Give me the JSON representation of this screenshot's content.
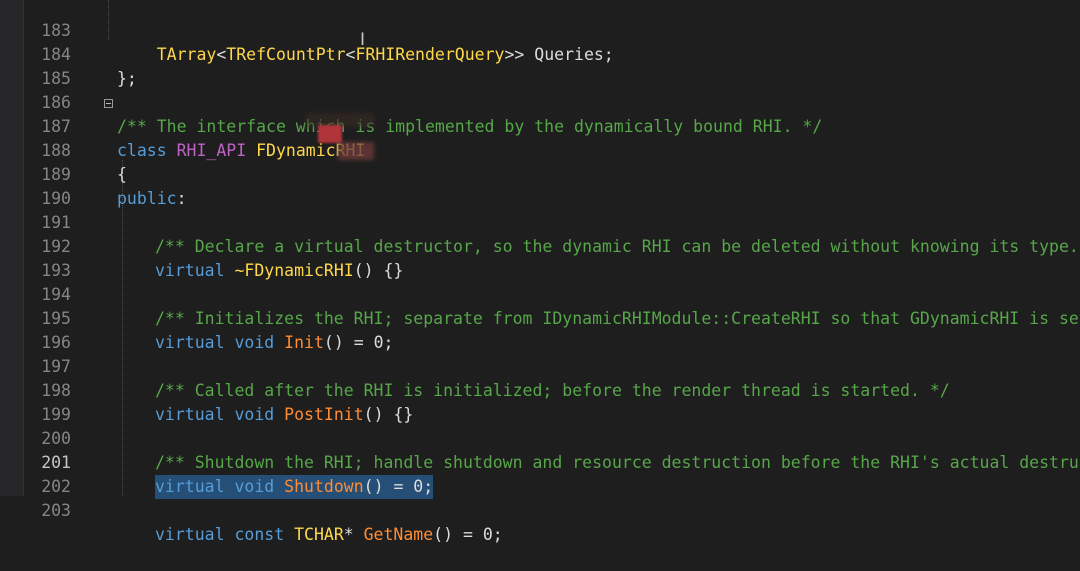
{
  "editor": {
    "lines": [
      {
        "num": "183",
        "text": "    TArray<TRefCountPtr<FRHIRenderQuery>> Queries;"
      },
      {
        "num": "184",
        "text": "};"
      },
      {
        "num": "185",
        "text": ""
      },
      {
        "num": "186",
        "text": "/** The interface which is implemented by the dynamically bound RHI. */"
      },
      {
        "num": "187",
        "text": "class RHI_API FDynamicRHI"
      },
      {
        "num": "188",
        "text": "{"
      },
      {
        "num": "189",
        "text": "public:"
      },
      {
        "num": "190",
        "text": ""
      },
      {
        "num": "191",
        "text": "    /** Declare a virtual destructor, so the dynamic RHI can be deleted without knowing its type. */"
      },
      {
        "num": "192",
        "text": "    virtual ~FDynamicRHI() {}"
      },
      {
        "num": "193",
        "text": ""
      },
      {
        "num": "194",
        "text": "    /** Initializes the RHI; separate from IDynamicRHIModule::CreateRHI so that GDynamicRHI is set wh"
      },
      {
        "num": "195",
        "text": "    virtual void Init() = 0;"
      },
      {
        "num": "196",
        "text": ""
      },
      {
        "num": "197",
        "text": "    /** Called after the RHI is initialized; before the render thread is started. */"
      },
      {
        "num": "198",
        "text": "    virtual void PostInit() {}"
      },
      {
        "num": "199",
        "text": ""
      },
      {
        "num": "200",
        "text": "    /** Shutdown the RHI; handle shutdown and resource destruction before the RHI's actual destructor"
      },
      {
        "num": "201",
        "text": "    virtual void Shutdown() = 0;"
      },
      {
        "num": "202",
        "text": ""
      },
      {
        "num": "203",
        "text": "    virtual const TCHAR* GetName() = 0;"
      }
    ],
    "current_line": "201",
    "colors": {
      "background": "#1e1e1e",
      "comment": "#57a64a",
      "keyword": "#569cd6",
      "function": "#ff8c33",
      "macro": "#bd63c5",
      "class_name": "#ffd84a",
      "selection": "#264f78"
    }
  },
  "code": {
    "l183": {
      "indent": "    ",
      "type1": "TArray",
      "p1": "<",
      "type2": "TRefCountPtr",
      "p2": "<",
      "type3": "FRHIRenderQuery",
      "p3": ">> Queries;"
    },
    "l184": {
      "text": "};"
    },
    "l186": {
      "comment": "/** The interface which is implemented by the dynamically bound RHI. */"
    },
    "l187": {
      "kw": "class",
      "macro": "RHI_API",
      "name": "FDynamicRHI"
    },
    "l188": {
      "text": "{"
    },
    "l189": {
      "kw": "public",
      "p": ":"
    },
    "l191": {
      "comment": "/** Declare a virtual destructor, so the dynamic RHI can be deleted without knowing its type. */"
    },
    "l192": {
      "kw": "virtual",
      "fn": "~FDynamicRHI",
      "p": "() {}"
    },
    "l194": {
      "comment": "/** Initializes the RHI; separate from IDynamicRHIModule::CreateRHI so that GDynamicRHI is set wh"
    },
    "l195": {
      "kw": "virtual void",
      "fn": "Init",
      "p": "() = 0;"
    },
    "l197": {
      "comment": "/** Called after the RHI is initialized; before the render thread is started. */"
    },
    "l198": {
      "kw": "virtual void",
      "fn": "PostInit",
      "p": "() {}"
    },
    "l200": {
      "comment": "/** Shutdown the RHI; handle shutdown and resource destruction before the RHI's actual destructor"
    },
    "l201": {
      "kw": "virtual void",
      "fn": "Shutdown",
      "p": "() = 0;"
    },
    "l203": {
      "kw": "virtual const",
      "type": "TCHAR",
      "p1": "* ",
      "fn": "GetName",
      "p2": "() = 0;"
    }
  },
  "icons": {
    "text_cursor": "I-beam-cursor-icon",
    "collapse": "collapse-toggle-icon"
  },
  "cursor_glyph": "I"
}
